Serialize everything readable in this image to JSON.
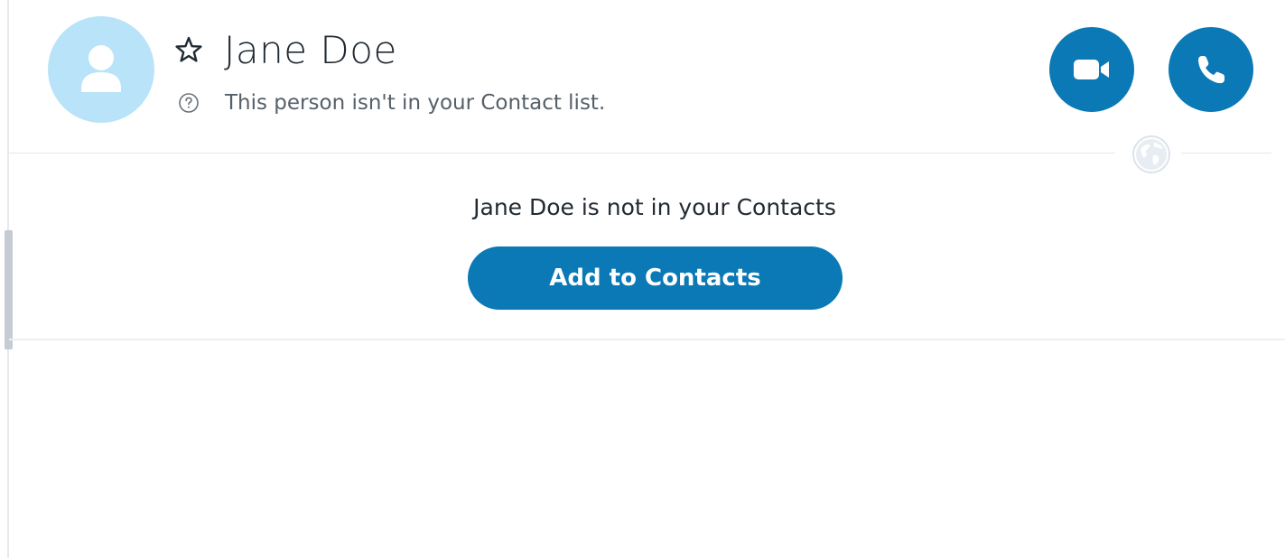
{
  "contact": {
    "name": "Jane Doe",
    "status": "This person isn't in your Contact list."
  },
  "banner": {
    "message": "Jane Doe is not in your Contacts",
    "add_button_label": "Add to Contacts"
  },
  "icons": {
    "avatar": "default-person-avatar",
    "favorite": "star-outline-icon",
    "status": "question-circle-icon",
    "video_call": "video-camera-icon",
    "audio_call": "phone-icon",
    "location": "globe-icon"
  },
  "colors": {
    "accent": "#0a79b5",
    "avatar_bg": "#b8e3f8",
    "text_primary": "#222a33",
    "text_secondary": "#55606a"
  }
}
